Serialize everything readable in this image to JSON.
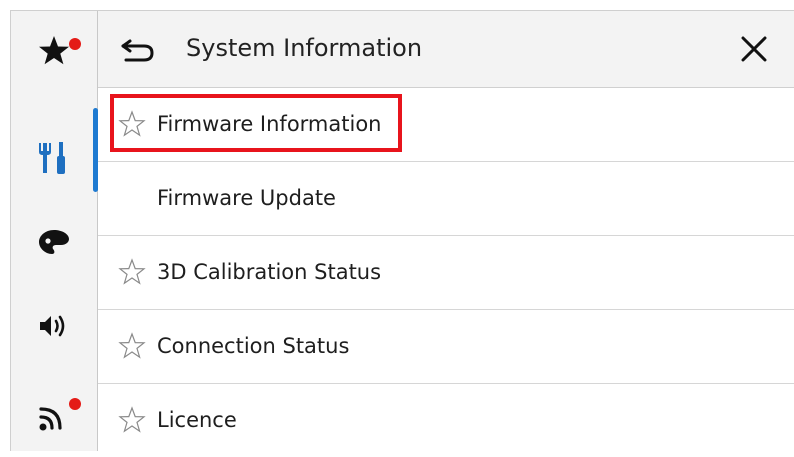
{
  "header": {
    "title": "System Information",
    "back_icon": "back-arrow-icon",
    "close_icon": "close-icon"
  },
  "sidebar": {
    "items": [
      {
        "icon": "favorites-star-icon",
        "has_badge": true
      },
      {
        "icon": "settings-tools-icon",
        "active": true
      },
      {
        "icon": "theme-palette-icon"
      },
      {
        "icon": "sound-speaker-icon"
      },
      {
        "icon": "wireless-signal-icon",
        "has_badge": true
      }
    ],
    "accent_color": "#1e7ad1",
    "badge_color": "#e41b17"
  },
  "list": {
    "items": [
      {
        "label": "Firmware Information",
        "starred_icon": true,
        "highlighted": true
      },
      {
        "label": "Firmware Update",
        "starred_icon": false
      },
      {
        "label": "3D Calibration Status",
        "starred_icon": true
      },
      {
        "label": "Connection Status",
        "starred_icon": true
      },
      {
        "label": "Licence",
        "starred_icon": true
      }
    ]
  },
  "highlight_color": "#e8141c"
}
